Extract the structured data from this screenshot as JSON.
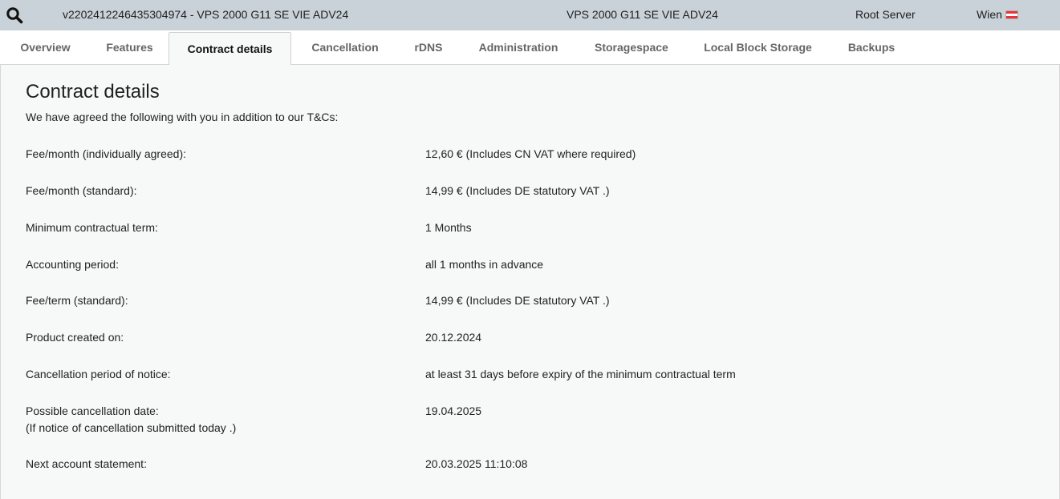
{
  "header": {
    "server_id": "v2202412246435304974 - VPS 2000 G11 SE VIE ADV24",
    "product": "VPS 2000 G11 SE VIE ADV24",
    "server_type": "Root Server",
    "location": "Wien",
    "flag_country": "Austria"
  },
  "tabs": [
    {
      "label": "Overview"
    },
    {
      "label": "Features"
    },
    {
      "label": "Contract details",
      "active": true
    },
    {
      "label": "Cancellation"
    },
    {
      "label": "rDNS"
    },
    {
      "label": "Administration"
    },
    {
      "label": "Storagespace"
    },
    {
      "label": "Local Block Storage"
    },
    {
      "label": "Backups"
    }
  ],
  "main": {
    "title": "Contract details",
    "intro": "We have agreed the following with you in addition to our T&Cs:",
    "rows": [
      {
        "label": "Fee/month (individually agreed):",
        "value": "12,60 € (Includes CN VAT where required)"
      },
      {
        "label": "Fee/month (standard):",
        "value": "14,99 € (Includes DE statutory VAT .)"
      },
      {
        "label": "Minimum contractual term:",
        "value": "1 Months"
      },
      {
        "label": "Accounting period:",
        "value": "all 1 months in advance"
      },
      {
        "label": "Fee/term (standard):",
        "value": "14,99 € (Includes DE statutory VAT .)"
      },
      {
        "label": "Product created on:",
        "value": "20.12.2024"
      },
      {
        "label": "Cancellation period of notice:",
        "value": "at least 31 days before expiry of the minimum contractual term"
      },
      {
        "label": "Possible cancellation date:",
        "sublabel": "(If notice of cancellation submitted today .)",
        "value": "19.04.2025"
      },
      {
        "label": "Next account statement:",
        "value": "20.03.2025 11:10:08"
      }
    ]
  },
  "colors": {
    "header_bg": "#c9d2d9",
    "content_bg": "#f7f8f8",
    "tab_text": "#666666",
    "tab_active_text": "#111111"
  }
}
